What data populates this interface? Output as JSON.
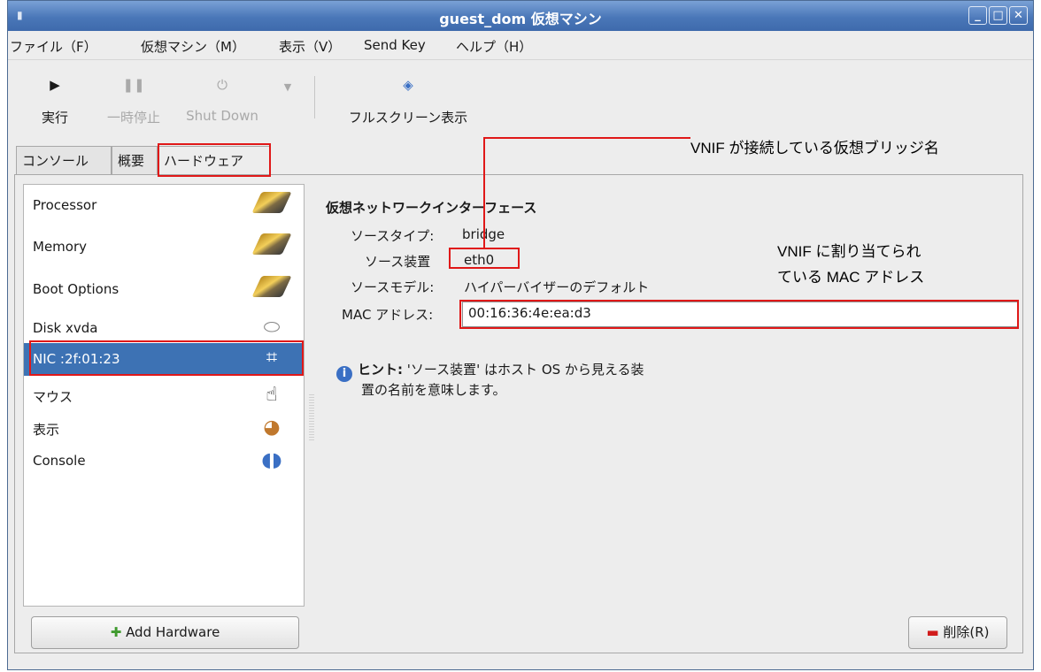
{
  "window": {
    "title": "guest_dom 仮想マシン",
    "accent": "#4a77b8",
    "controls": {
      "minimize": "_",
      "maximize": "□",
      "close": "✕"
    }
  },
  "menu": {
    "file": "ファイル（F）",
    "vm": "仮想マシン（M）",
    "view": "表示（V）",
    "sendkey": "Send Key",
    "help": "ヘルプ（H）"
  },
  "toolbar": {
    "run_label": "実行",
    "pause_label": "一時停止",
    "shutdown_label": "Shut Down",
    "fullscreen_label": "フルスクリーン表示"
  },
  "tabs": [
    {
      "label": "コンソール",
      "active": false
    },
    {
      "label": "概要",
      "active": false
    },
    {
      "label": "ハードウェア",
      "active": true
    }
  ],
  "hardware_list": [
    {
      "label": "Processor",
      "icon": "chip-icon"
    },
    {
      "label": "Memory",
      "icon": "chip-icon"
    },
    {
      "label": "Boot Options",
      "icon": "chip-icon"
    },
    {
      "label": "Disk xvda",
      "icon": "disk-icon"
    },
    {
      "label": "NIC :2f:01:23",
      "icon": "network-icon",
      "selected": true
    },
    {
      "label": "マウス",
      "icon": "mouse-icon"
    },
    {
      "label": "表示",
      "icon": "display-icon"
    },
    {
      "label": "Console",
      "icon": "console-icon"
    }
  ],
  "add_hardware_label": "Add Hardware",
  "details": {
    "heading": "仮想ネットワークインターフェース",
    "source_type_label": "ソースタイプ:",
    "source_type_value": "bridge",
    "source_device_label": "ソース装置",
    "source_device_value": "eth0",
    "source_model_label": "ソースモデル:",
    "source_model_value": "ハイパーバイザーのデフォルト",
    "mac_label": "MAC アドレス:",
    "mac_value": "00:16:36:4e:ea:d3",
    "hint_bold": "ヒント:",
    "hint_line1": "'ソース装置' はホスト OS から見える装",
    "hint_line2": "置の名前を意味します。"
  },
  "remove_label": "削除(R)",
  "annotations": {
    "bridge_note": "VNIF が接続している仮想ブリッジ名",
    "mac_note_line1": "VNIF に割り当てられ",
    "mac_note_line2": "ている MAC アドレス",
    "highlight_color": "#e01818"
  }
}
